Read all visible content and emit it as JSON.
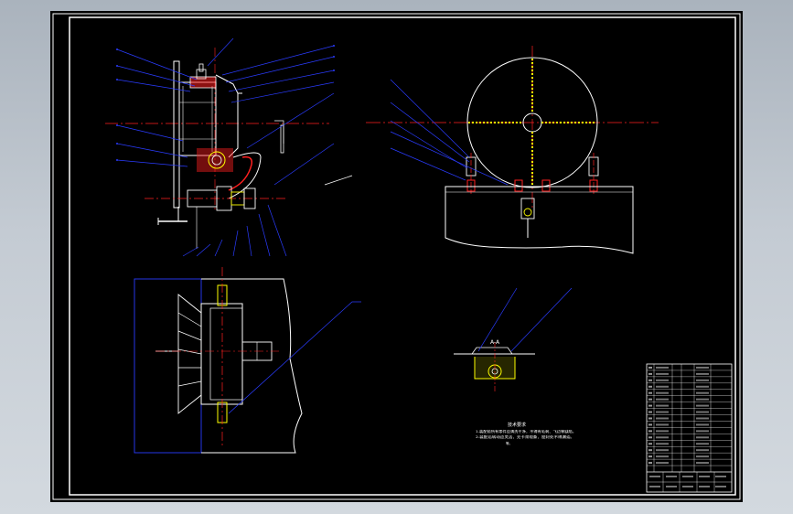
{
  "drawing": {
    "background": "#000000",
    "frame_color": "#ffffff",
    "leader_color": "#2a3cff",
    "center_line_color": "#ff2020",
    "accent_color": "#ffff00",
    "section_view_label": "A-A",
    "notes_title": "技术要求",
    "notes_lines": [
      "1.装配前所有零件应清洗干净，不得有毛刺、飞边等缺陷。",
      "2.装配后转动应灵活，无卡滞现象，密封处不得漏油。"
    ],
    "notes_suffix": "等。"
  }
}
